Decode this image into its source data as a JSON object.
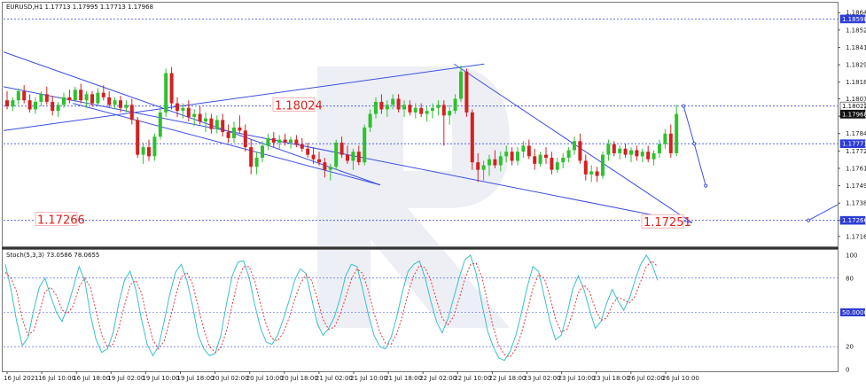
{
  "chart_data": [
    {
      "type": "candlestick",
      "title": "EURUSD,H1  1.17713 1.17995 1.17713 1.17968",
      "ylim": [
        1.171,
        1.187
      ],
      "y_ticks": [
        1.1864,
        1.18525,
        1.1841,
        1.18295,
        1.1818,
        1.1807,
        1.17955,
        1.1784,
        1.17725,
        1.1761,
        1.17495,
        1.1738,
        1.17266,
        1.1716
      ],
      "price_tags": [
        {
          "value": 1.18598,
          "label": "1.18598",
          "bg": "#2d3cd6",
          "fg": "#ffffff"
        },
        {
          "value": 1.18022,
          "label": "1.18022",
          "bg": "#ffffff",
          "fg": "#111111"
        },
        {
          "value": 1.17968,
          "label": "1.17968",
          "bg": "#111111",
          "fg": "#ffffff"
        },
        {
          "value": 1.17773,
          "label": "1.17773",
          "bg": "#2d3cd6",
          "fg": "#ffffff"
        },
        {
          "value": 1.17266,
          "label": "1.17266",
          "bg": "#2d3cd6",
          "fg": "#ffffff"
        }
      ],
      "levels": [
        1.18598,
        1.18022,
        1.17773,
        1.17266
      ],
      "annotations": [
        {
          "text": "1.18024",
          "value": 1.18024
        },
        {
          "text": "1.17266",
          "value": 1.17266
        },
        {
          "text": "1.17251",
          "value": 1.17251
        }
      ],
      "x_labels": [
        "16 Jul 2021",
        "16 Jul 10:00",
        "16 Jul 18:00",
        "19 Jul 02:00",
        "19 Jul 10:00",
        "19 Jul 18:00",
        "20 Jul 02:00",
        "20 Jul 10:00",
        "20 Jul 18:00",
        "21 Jul 02:00",
        "21 Jul 10:00",
        "21 Jul 18:00",
        "22 Jul 02:00",
        "22 Jul 10:00",
        "22 Jul 18:00",
        "23 Jul 02:00",
        "23 Jul 10:00",
        "23 Jul 18:00",
        "26 Jul 02:00",
        "26 Jul 10:00"
      ],
      "colors": {
        "up": "#2fc12f",
        "down": "#d42020",
        "lines": "#3d4fe0"
      },
      "candles": [
        [
          1.1806,
          1.1812,
          1.18,
          1.1802
        ],
        [
          1.1802,
          1.1808,
          1.1799,
          1.1806
        ],
        [
          1.1806,
          1.1814,
          1.1803,
          1.1812
        ],
        [
          1.1812,
          1.1816,
          1.1804,
          1.1806
        ],
        [
          1.1806,
          1.181,
          1.1798,
          1.18
        ],
        [
          1.18,
          1.1808,
          1.1797,
          1.1805
        ],
        [
          1.1805,
          1.1812,
          1.1802,
          1.181
        ],
        [
          1.181,
          1.1815,
          1.1803,
          1.1805
        ],
        [
          1.1805,
          1.1809,
          1.1796,
          1.1799
        ],
        [
          1.1799,
          1.1805,
          1.1795,
          1.1803
        ],
        [
          1.1803,
          1.1811,
          1.1801,
          1.1808
        ],
        [
          1.1808,
          1.1813,
          1.1804,
          1.1806
        ],
        [
          1.1806,
          1.1815,
          1.1805,
          1.1813
        ],
        [
          1.1813,
          1.1817,
          1.1804,
          1.1806
        ],
        [
          1.1806,
          1.1812,
          1.1801,
          1.181
        ],
        [
          1.181,
          1.1812,
          1.1802,
          1.1804
        ],
        [
          1.1804,
          1.1814,
          1.1803,
          1.1811
        ],
        [
          1.1811,
          1.1816,
          1.1806,
          1.1808
        ],
        [
          1.1808,
          1.1812,
          1.1801,
          1.1803
        ],
        [
          1.1803,
          1.1808,
          1.18,
          1.1806
        ],
        [
          1.1806,
          1.1809,
          1.1798,
          1.1801
        ],
        [
          1.1801,
          1.1806,
          1.1798,
          1.1803
        ],
        [
          1.1803,
          1.1807,
          1.179,
          1.1793
        ],
        [
          1.1793,
          1.1795,
          1.1768,
          1.177
        ],
        [
          1.177,
          1.1778,
          1.1764,
          1.1775
        ],
        [
          1.1775,
          1.178,
          1.1766,
          1.1769
        ],
        [
          1.1769,
          1.1784,
          1.1766,
          1.1782
        ],
        [
          1.1782,
          1.18,
          1.178,
          1.1798
        ],
        [
          1.1798,
          1.1827,
          1.1795,
          1.1824
        ],
        [
          1.1824,
          1.1828,
          1.18,
          1.1804
        ],
        [
          1.1804,
          1.1808,
          1.1795,
          1.1799
        ],
        [
          1.1799,
          1.1804,
          1.1794,
          1.1801
        ],
        [
          1.1801,
          1.1806,
          1.1792,
          1.1795
        ],
        [
          1.1795,
          1.18,
          1.1789,
          1.1797
        ],
        [
          1.1797,
          1.1802,
          1.179,
          1.1792
        ],
        [
          1.1792,
          1.1798,
          1.1785,
          1.1794
        ],
        [
          1.1794,
          1.1797,
          1.1784,
          1.1787
        ],
        [
          1.1787,
          1.1796,
          1.1784,
          1.1793
        ],
        [
          1.1793,
          1.1797,
          1.1782,
          1.1785
        ],
        [
          1.1785,
          1.179,
          1.1778,
          1.1781
        ],
        [
          1.1781,
          1.1792,
          1.1778,
          1.1788
        ],
        [
          1.1788,
          1.1796,
          1.1784,
          1.1786
        ],
        [
          1.1786,
          1.179,
          1.1772,
          1.1775
        ],
        [
          1.1775,
          1.178,
          1.1757,
          1.1762
        ],
        [
          1.1762,
          1.1772,
          1.1757,
          1.1768
        ],
        [
          1.1768,
          1.1779,
          1.1765,
          1.1776
        ],
        [
          1.1776,
          1.1784,
          1.1773,
          1.1781
        ],
        [
          1.1781,
          1.1785,
          1.1775,
          1.1778
        ],
        [
          1.1778,
          1.1783,
          1.1774,
          1.178
        ],
        [
          1.178,
          1.1784,
          1.1776,
          1.1778
        ],
        [
          1.1778,
          1.1782,
          1.1774,
          1.178
        ],
        [
          1.178,
          1.1783,
          1.1775,
          1.1777
        ],
        [
          1.1777,
          1.1781,
          1.1772,
          1.1774
        ],
        [
          1.1774,
          1.1778,
          1.1768,
          1.177
        ],
        [
          1.177,
          1.1775,
          1.1764,
          1.1767
        ],
        [
          1.1767,
          1.1772,
          1.1763,
          1.1765
        ],
        [
          1.1765,
          1.1768,
          1.1755,
          1.176
        ],
        [
          1.176,
          1.1764,
          1.1753,
          1.1762
        ],
        [
          1.1762,
          1.178,
          1.176,
          1.1778
        ],
        [
          1.1778,
          1.1782,
          1.1768,
          1.177
        ],
        [
          1.177,
          1.1776,
          1.1764,
          1.1766
        ],
        [
          1.1766,
          1.1774,
          1.176,
          1.1772
        ],
        [
          1.1772,
          1.1776,
          1.1763,
          1.1765
        ],
        [
          1.1765,
          1.179,
          1.1763,
          1.1788
        ],
        [
          1.1788,
          1.18,
          1.1785,
          1.1797
        ],
        [
          1.1797,
          1.1808,
          1.1794,
          1.1805
        ],
        [
          1.1805,
          1.181,
          1.1797,
          1.18
        ],
        [
          1.18,
          1.1806,
          1.1795,
          1.1803
        ],
        [
          1.1803,
          1.181,
          1.18,
          1.1807
        ],
        [
          1.1807,
          1.181,
          1.1798,
          1.18
        ],
        [
          1.18,
          1.1806,
          1.1795,
          1.1803
        ],
        [
          1.1803,
          1.1806,
          1.1796,
          1.1798
        ],
        [
          1.1798,
          1.1804,
          1.1794,
          1.1801
        ],
        [
          1.1801,
          1.1804,
          1.1795,
          1.1797
        ],
        [
          1.1797,
          1.1802,
          1.1792,
          1.1799
        ],
        [
          1.1799,
          1.1804,
          1.1794,
          1.1801
        ],
        [
          1.1801,
          1.1806,
          1.1796,
          1.1803
        ],
        [
          1.1803,
          1.1806,
          1.1776,
          1.1796
        ],
        [
          1.1796,
          1.1803,
          1.179,
          1.1799
        ],
        [
          1.1799,
          1.181,
          1.1797,
          1.1807
        ],
        [
          1.1807,
          1.1829,
          1.1805,
          1.1825
        ],
        [
          1.1825,
          1.1827,
          1.1795,
          1.1798
        ],
        [
          1.1798,
          1.18,
          1.176,
          1.1765
        ],
        [
          1.1765,
          1.1771,
          1.1752,
          1.176
        ],
        [
          1.176,
          1.1766,
          1.1753,
          1.1763
        ],
        [
          1.1763,
          1.177,
          1.1756,
          1.1767
        ],
        [
          1.1767,
          1.1773,
          1.1761,
          1.1763
        ],
        [
          1.1763,
          1.1772,
          1.1759,
          1.1769
        ],
        [
          1.1769,
          1.1776,
          1.1765,
          1.1772
        ],
        [
          1.1772,
          1.1775,
          1.1763,
          1.1766
        ],
        [
          1.1766,
          1.1775,
          1.1763,
          1.1772
        ],
        [
          1.1772,
          1.1779,
          1.1768,
          1.1776
        ],
        [
          1.1776,
          1.178,
          1.1767,
          1.1769
        ],
        [
          1.1769,
          1.1774,
          1.176,
          1.1764
        ],
        [
          1.1764,
          1.1772,
          1.1762,
          1.177
        ],
        [
          1.177,
          1.1775,
          1.1764,
          1.1768
        ],
        [
          1.1768,
          1.1772,
          1.1757,
          1.176
        ],
        [
          1.176,
          1.1768,
          1.1758,
          1.1765
        ],
        [
          1.1765,
          1.1771,
          1.1761,
          1.1768
        ],
        [
          1.1768,
          1.1775,
          1.1765,
          1.1773
        ],
        [
          1.1773,
          1.1782,
          1.177,
          1.1779
        ],
        [
          1.1779,
          1.1784,
          1.1764,
          1.1766
        ],
        [
          1.1766,
          1.177,
          1.1753,
          1.1757
        ],
        [
          1.1757,
          1.1763,
          1.1752,
          1.1759
        ],
        [
          1.1759,
          1.1762,
          1.1752,
          1.1756
        ],
        [
          1.1756,
          1.1772,
          1.1754,
          1.177
        ],
        [
          1.177,
          1.178,
          1.1766,
          1.1777
        ],
        [
          1.1777,
          1.1779,
          1.1769,
          1.1771
        ],
        [
          1.1771,
          1.1776,
          1.1767,
          1.1774
        ],
        [
          1.1774,
          1.1777,
          1.1768,
          1.177
        ],
        [
          1.177,
          1.1775,
          1.1765,
          1.1773
        ],
        [
          1.1773,
          1.1776,
          1.1766,
          1.1769
        ],
        [
          1.1769,
          1.1774,
          1.1765,
          1.1772
        ],
        [
          1.1772,
          1.1776,
          1.1765,
          1.1767
        ],
        [
          1.1767,
          1.1773,
          1.1763,
          1.1771
        ],
        [
          1.1771,
          1.178,
          1.1768,
          1.1777
        ],
        [
          1.1777,
          1.1787,
          1.1774,
          1.1784
        ],
        [
          1.1784,
          1.179,
          1.1768,
          1.1771
        ],
        [
          1.1771,
          1.1803,
          1.1769,
          1.1797
        ]
      ],
      "trendlines": [
        [
          [
            "16 Jul 2021",
            1.1838
          ],
          [
            "21 Jul 10:00",
            1.175
          ]
        ],
        [
          [
            "16 Jul 2021",
            1.1786
          ],
          [
            "22 Jul 10:00",
            1.183
          ]
        ],
        [
          [
            "16 Jul 2021",
            1.1815
          ],
          [
            "26 Jul 10:00",
            1.1725
          ]
        ],
        [
          [
            "22 Jul 10:00",
            1.183
          ],
          [
            "26 Jul 10:00",
            1.1725
          ]
        ],
        [
          [
            "16 Jul 18:00",
            1.1804
          ],
          [
            "21 Jul 10:00",
            1.175
          ]
        ]
      ],
      "forecast_path": [
        1.18022,
        1.17773,
        1.17495
      ]
    },
    {
      "type": "line",
      "title": "Stoch(5,3,3) 73.0586 78.0655",
      "ylim": [
        0,
        100
      ],
      "y_ticks": [
        100,
        80,
        20,
        0
      ],
      "levels": [
        80,
        50,
        20
      ],
      "level_tag": "50.0000",
      "series": [
        {
          "name": "%K",
          "color": "#3bc0c8",
          "style": "solid",
          "values": [
            92,
            70,
            42,
            21,
            28,
            52,
            72,
            80,
            64,
            50,
            42,
            55,
            72,
            90,
            78,
            48,
            26,
            15,
            18,
            32,
            58,
            78,
            86,
            70,
            44,
            22,
            12,
            20,
            42,
            66,
            85,
            92,
            78,
            56,
            30,
            18,
            12,
            14,
            30,
            58,
            82,
            94,
            95,
            80,
            56,
            36,
            24,
            22,
            30,
            44,
            60,
            78,
            88,
            84,
            62,
            40,
            30,
            36,
            46,
            62,
            82,
            92,
            90,
            70,
            48,
            30,
            20,
            18,
            28,
            46,
            68,
            86,
            92,
            95,
            80,
            60,
            42,
            32,
            44,
            62,
            80,
            96,
            100,
            84,
            58,
            34,
            20,
            10,
            8,
            16,
            30,
            50,
            72,
            90,
            86,
            64,
            42,
            26,
            30,
            48,
            70,
            82,
            70,
            52,
            36,
            42,
            58,
            70,
            60,
            52,
            62,
            78,
            92,
            100,
            92,
            78
          ]
        },
        {
          "name": "%D",
          "color": "#e23a3a",
          "style": "dashed",
          "values": [
            85,
            80,
            68,
            44,
            30,
            34,
            50,
            68,
            72,
            65,
            52,
            49,
            56,
            72,
            80,
            72,
            51,
            30,
            20,
            22,
            36,
            56,
            74,
            78,
            67,
            45,
            26,
            18,
            25,
            43,
            64,
            81,
            85,
            75,
            55,
            35,
            20,
            15,
            19,
            34,
            57,
            78,
            90,
            90,
            77,
            57,
            39,
            27,
            25,
            32,
            45,
            61,
            75,
            83,
            78,
            62,
            44,
            35,
            37,
            48,
            63,
            79,
            88,
            84,
            69,
            49,
            33,
            23,
            22,
            31,
            47,
            67,
            82,
            91,
            89,
            78,
            61,
            45,
            39,
            46,
            62,
            79,
            92,
            93,
            81,
            59,
            37,
            21,
            13,
            11,
            18,
            32,
            51,
            71,
            83,
            80,
            64,
            44,
            33,
            35,
            49,
            67,
            74,
            68,
            53,
            43,
            45,
            57,
            63,
            61,
            58,
            64,
            77,
            90,
            95,
            90
          ]
        }
      ]
    }
  ]
}
